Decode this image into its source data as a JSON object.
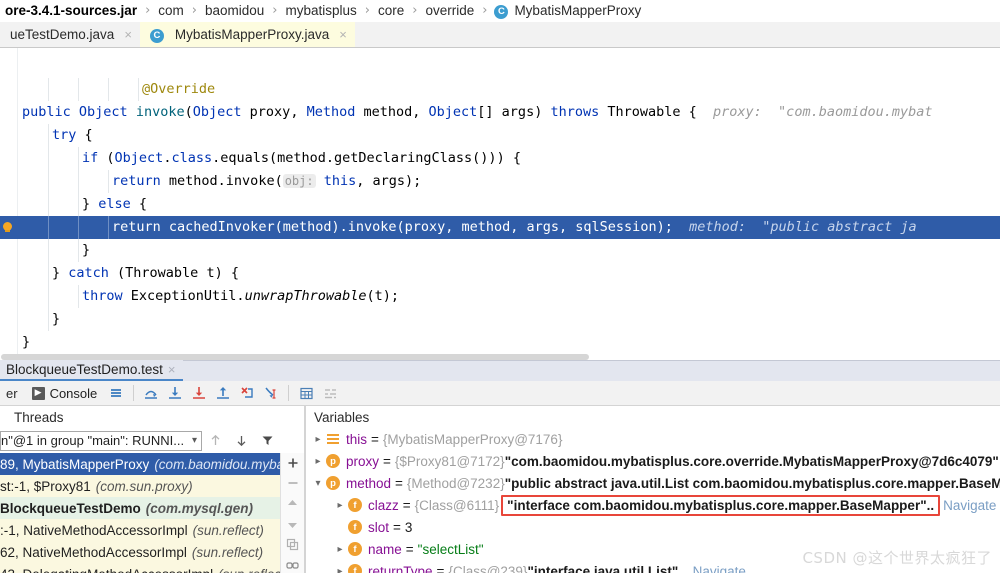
{
  "breadcrumb": {
    "items": [
      {
        "label": "ore-3.4.1-sources.jar",
        "bold": true
      },
      {
        "label": "com"
      },
      {
        "label": "baomidou"
      },
      {
        "label": "mybatisplus"
      },
      {
        "label": "core"
      },
      {
        "label": "override"
      },
      {
        "label": "MybatisMapperProxy",
        "icon": "class-badge-icon",
        "badge": "C"
      }
    ],
    "separator": "›"
  },
  "editor_tabs": [
    {
      "label": "ueTestDemo.java",
      "active": false,
      "close": "×"
    },
    {
      "label": "MybatisMapperProxy.java",
      "active": true,
      "badge": "C",
      "close": "×"
    }
  ],
  "code": {
    "lines": [
      {
        "text": "@Override",
        "tokens": [
          {
            "t": "@Override",
            "c": "anno"
          }
        ],
        "indent": 4
      },
      {
        "tokens": [
          {
            "t": "public",
            "c": "kw"
          },
          {
            "t": " "
          },
          {
            "t": "Object",
            "c": "kw"
          },
          {
            "t": " "
          },
          {
            "t": "invoke",
            "c": "fn"
          },
          {
            "t": "("
          },
          {
            "t": "Object",
            "c": "kw"
          },
          {
            "t": " proxy, "
          },
          {
            "t": "Method",
            "c": "kw"
          },
          {
            "t": " method, "
          },
          {
            "t": "Object",
            "c": "kw"
          },
          {
            "t": "[] args) "
          },
          {
            "t": "throws",
            "c": "kw"
          },
          {
            "t": " Throwable {"
          }
        ],
        "hint": "proxy:  \"com.baomidou.mybat"
      },
      {
        "tokens": [
          {
            "t": "try",
            "c": "kw"
          },
          {
            "t": " {"
          }
        ],
        "indent": 1
      },
      {
        "tokens": [
          {
            "t": "if",
            "c": "kw"
          },
          {
            "t": " ("
          },
          {
            "t": "Object",
            "c": "kw"
          },
          {
            "t": "."
          },
          {
            "t": "class",
            "c": "kw"
          },
          {
            "t": ".equals(method.getDeclaringClass())) {"
          }
        ],
        "indent": 2
      },
      {
        "tokens": [
          {
            "t": "return",
            "c": "kw"
          },
          {
            "t": " method.invoke("
          },
          {
            "t": "obj:",
            "c": "param"
          },
          {
            "t": " "
          },
          {
            "t": "this",
            "c": "kw"
          },
          {
            "t": ", args);"
          }
        ],
        "indent": 3
      },
      {
        "tokens": [
          {
            "t": "} "
          },
          {
            "t": "else",
            "c": "kw"
          },
          {
            "t": " {"
          }
        ],
        "indent": 2
      },
      {
        "tokens": [
          {
            "t": "return",
            "c": "kw"
          },
          {
            "t": " cachedInvoker(method).invoke(proxy, method, args, sqlSession);"
          }
        ],
        "indent": 3,
        "highlight": true,
        "bulb": true,
        "hint": "method:  \"public abstract ja"
      },
      {
        "tokens": [
          {
            "t": "}"
          }
        ],
        "indent": 2
      },
      {
        "tokens": [
          {
            "t": "} "
          },
          {
            "t": "catch",
            "c": "kw"
          },
          {
            "t": " (Throwable t) {"
          }
        ],
        "indent": 1
      },
      {
        "tokens": [
          {
            "t": "throw",
            "c": "kw"
          },
          {
            "t": " ExceptionUtil."
          },
          {
            "t": "unwrapThrowable",
            "c": "italic"
          },
          {
            "t": "(t);"
          }
        ],
        "indent": 2
      },
      {
        "tokens": [
          {
            "t": "}"
          }
        ],
        "indent": 1
      },
      {
        "tokens": [
          {
            "t": "}"
          }
        ],
        "indent": 0
      }
    ]
  },
  "debug_window": {
    "tab_label": "BlockqueueTestDemo.test",
    "tab_close": "×",
    "toolbar": {
      "left_tab_label": "er",
      "console_label": "Console",
      "console_icon": "▶",
      "buttons": [
        {
          "name": "show-execution-point-icon",
          "title": "lines-icon"
        },
        {
          "name": "step-over-icon",
          "title": "step-over"
        },
        {
          "name": "step-into-icon",
          "title": "step-into"
        },
        {
          "name": "force-step-into-icon",
          "title": "force-step-into"
        },
        {
          "name": "step-out-icon",
          "title": "step-out"
        },
        {
          "name": "drop-frame-icon",
          "title": "drop-frame"
        },
        {
          "name": "run-to-cursor-icon",
          "title": "run-to-cursor"
        },
        {
          "name": "evaluate-expression-icon",
          "title": "evaluate"
        },
        {
          "name": "settings-icon",
          "title": "layout"
        }
      ]
    }
  },
  "threads_panel": {
    "title": "Threads",
    "selected_thread": "n\"@1 in group \"main\": RUNNI...",
    "dropdown_arrow": "⌄",
    "controls": [
      "arrow-up-icon",
      "arrow-down-icon",
      "filter-icon"
    ],
    "side_buttons": [
      "plus-icon",
      "minus-icon",
      "up-icon",
      "down-icon",
      "copy-icon",
      "link-icon"
    ],
    "frames": [
      {
        "label": "89, MybatisMapperProxy",
        "pkg": "(com.baomidou.mybatis",
        "state": "selected"
      },
      {
        "label": "st:-1, $Proxy81",
        "pkg": "(com.sun.proxy)",
        "state": "yellow"
      },
      {
        "label": "BlockqueueTestDemo",
        "pkg": "(com.mysql.gen)",
        "state": "green",
        "bold": true
      },
      {
        "label": ":-1, NativeMethodAccessorImpl",
        "pkg": "(sun.reflect)",
        "state": "yellow"
      },
      {
        "label": "62, NativeMethodAccessorImpl",
        "pkg": "(sun.reflect)",
        "state": "yellow"
      },
      {
        "label": "43, DelegatingMethodAccessorImpl",
        "pkg": "(sun.reflect)",
        "state": "yellow"
      }
    ]
  },
  "variables_panel": {
    "title": "Variables",
    "rows": [
      {
        "indent": 0,
        "chevron": "›",
        "icon": "eq",
        "icon_label": "",
        "name": "this",
        "ref": "{MybatisMapperProxy@7176}",
        "value": "",
        "nav": ""
      },
      {
        "indent": 0,
        "chevron": "›",
        "icon": "p",
        "icon_label": "p",
        "name": "proxy",
        "ref": "{$Proxy81@7172}",
        "value": "\"com.baomidou.mybatisplus.core.override.MybatisMapperProxy@7d6c4079\"",
        "nav": ""
      },
      {
        "indent": 0,
        "chevron": "⌄",
        "icon": "p",
        "icon_label": "p",
        "name": "method",
        "ref": "{Method@7232}",
        "value": "\"public abstract java.util.List com.baomidou.mybatisplus.core.mapper.BaseMapper.",
        "nav": ""
      },
      {
        "indent": 1,
        "chevron": "›",
        "icon": "f",
        "icon_label": "f",
        "name": "clazz",
        "ref": "{Class@6111}",
        "value": "\"interface com.baomidou.mybatisplus.core.mapper.BaseMapper\"..",
        "highlight_box": true,
        "nav": "Navigate"
      },
      {
        "indent": 1,
        "chevron": "",
        "icon": "f",
        "icon_label": "f",
        "name": "slot",
        "ref": "",
        "value": "3",
        "value_kind": "number",
        "nav": ""
      },
      {
        "indent": 1,
        "chevron": "›",
        "icon": "f",
        "icon_label": "f",
        "name": "name",
        "ref": "",
        "value": "\"selectList\"",
        "value_kind": "string-green",
        "nav": ""
      },
      {
        "indent": 1,
        "chevron": "›",
        "icon": "f",
        "icon_label": "f",
        "name": "returnType",
        "ref": "{Class@239}",
        "value": "\"interface java.util.List\"",
        "dots": "...",
        "nav": "Navigate"
      }
    ]
  },
  "watermark": "CSDN @这个世界太疯狂了",
  "colors": {
    "selection_blue": "#2f5ca8",
    "accent_orange": "#f0a030",
    "keyword_blue": "#0033b3",
    "string_green": "#067d17",
    "highlight_red": "#e8463a",
    "active_tab_yellow": "#fdfcdf"
  }
}
